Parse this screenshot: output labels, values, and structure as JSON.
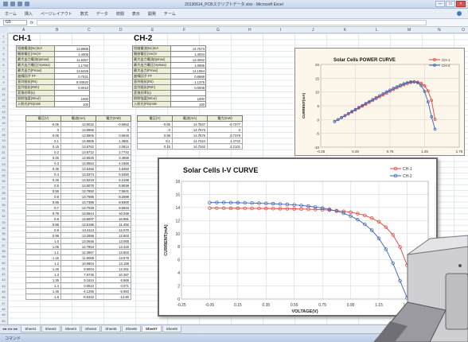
{
  "window": {
    "title": "20130614_PCBスクリプトデータ.xlsx - Microsoft Excel",
    "minimize": "—",
    "maximize": "□",
    "close": "×"
  },
  "ribbon": {
    "tabs": [
      "ホーム",
      "挿入",
      "ページレイアウト",
      "数式",
      "データ",
      "校閲",
      "表示",
      "開発",
      "チーム"
    ]
  },
  "formula": {
    "namebox": "G5",
    "fx": "fx",
    "value": ""
  },
  "columns": [
    "A",
    "B",
    "C",
    "D",
    "E",
    "F",
    "G",
    "H",
    "I",
    "J",
    "K",
    "L",
    "M",
    "N",
    "O"
  ],
  "rows": [
    "1",
    "2",
    "3",
    "4",
    "5",
    "6",
    "7",
    "8",
    "9",
    "10",
    "11",
    "12",
    "13",
    "14",
    "15",
    "16",
    "17",
    "18",
    "19",
    "20",
    "21",
    "22",
    "23",
    "24",
    "25",
    "26",
    "27",
    "28",
    "29",
    "30",
    "31",
    "32",
    "33",
    "34",
    "35",
    "36",
    "37",
    "38",
    "39",
    "40",
    "41",
    "42",
    "43",
    "44",
    "45",
    "46",
    "47",
    "48",
    "49",
    "50"
  ],
  "ch1": {
    "title": "CH-1",
    "params": [
      [
        "短絡電流(Isc)mA",
        "13.8966"
      ],
      [
        "開放電圧(Voc)V",
        "1.4006"
      ],
      [
        "最大出力電流(Ipmax)",
        "11.6357"
      ],
      [
        "最大出力電圧(Vpmax)",
        "1.1750"
      ],
      [
        "最大出力(Pmax)",
        "13.6426"
      ],
      [
        "曲線因子 FF",
        "0.7021"
      ],
      [
        "直列抵抗(Rs)",
        "0.00920"
      ],
      [
        "並列抵抗(Rsh)",
        "0.0010"
      ],
      [
        "変換効率(η)",
        ""
      ],
      [
        "照射強度(W/㎡)",
        "1000"
      ],
      [
        "入射光(Pin)mW",
        "100"
      ]
    ],
    "headers": [
      "電圧(V)",
      "電流(mA)",
      "電力(mW)"
    ],
    "data": [
      [
        "-0.05",
        "13.9032",
        "-0.6952"
      ],
      [
        "0",
        "13.8966",
        "0"
      ],
      [
        "0.05",
        "13.8905",
        "0.6945"
      ],
      [
        "0.1",
        "13.8806",
        "1.3881"
      ],
      [
        "0.15",
        "13.8762",
        "2.0814"
      ],
      [
        "0.2",
        "13.8712",
        "2.7742"
      ],
      [
        "0.25",
        "13.8625",
        "3.4656"
      ],
      [
        "0.3",
        "13.8554",
        "4.1566"
      ],
      [
        "0.35",
        "13.8458",
        "4.8460"
      ],
      [
        "0.4",
        "13.8374",
        "5.5350"
      ],
      [
        "0.45",
        "13.8218",
        "6.2198"
      ],
      [
        "0.5",
        "13.8076",
        "6.9038"
      ],
      [
        "0.55",
        "13.7893",
        "7.5841"
      ],
      [
        "0.6",
        "13.7665",
        "8.2599"
      ],
      [
        "0.65",
        "13.7385",
        "8.9300"
      ],
      [
        "0.7",
        "13.7033",
        "9.5923"
      ],
      [
        "0.75",
        "13.6614",
        "10.246"
      ],
      [
        "0.8",
        "13.6007",
        "10.881"
      ],
      [
        "0.85",
        "13.5196",
        "11.492"
      ],
      [
        "0.9",
        "13.4113",
        "12.070"
      ],
      [
        "0.95",
        "13.2658",
        "12.603"
      ],
      [
        "1.0",
        "13.0646",
        "13.065"
      ],
      [
        "1.05",
        "12.7853",
        "13.425"
      ],
      [
        "1.1",
        "12.3667",
        "13.603"
      ],
      [
        "1.15",
        "11.8069",
        "13.578"
      ],
      [
        "1.2",
        "10.9904",
        "13.188"
      ],
      [
        "1.25",
        "9.8004",
        "12.251"
      ],
      [
        "1.3",
        "7.9745",
        "10.367"
      ],
      [
        "1.35",
        "5.1624",
        "6.969"
      ],
      [
        "1.4",
        "0.0510",
        "0.071"
      ],
      [
        "1.45",
        "-4.1265",
        "-5.983"
      ],
      [
        "1.5",
        "-8.5342",
        "-12.80"
      ]
    ]
  },
  "ch2": {
    "title": "CH-2",
    "params": [
      [
        "短絡電流(Isc)mA",
        "14.7573"
      ],
      [
        "開放電圧(Voc)V",
        "1.4004"
      ],
      [
        "最大出力電流(Ipmax)",
        "13.3052"
      ],
      [
        "最大出力電圧(Vpmax)",
        "1.0695"
      ],
      [
        "最大出力(Pmax)",
        "14.1954"
      ],
      [
        "曲線因子 FF",
        "0.6869"
      ],
      [
        "直列抵抗(Rs)",
        "1.1375"
      ],
      [
        "並列抵抗(Rsh)",
        "0.0008"
      ],
      [
        "変換効率(η)",
        ""
      ],
      [
        "照射強度(W/㎡)",
        "1000"
      ],
      [
        "入射光(Pin)mW",
        "100"
      ]
    ],
    "headers": [
      "電圧(V)",
      "電流(mA)",
      "電力(mW)"
    ],
    "data": [
      [
        "-0.05",
        "14.7547",
        "-0.7377"
      ],
      [
        "0",
        "14.7573",
        "0"
      ],
      [
        "0.05",
        "14.7576",
        "0.7379"
      ],
      [
        "0.1",
        "14.7424",
        "1.4742"
      ],
      [
        "0.15",
        "14.7342",
        "2.2101"
      ]
    ]
  },
  "sheets": [
    "Sheet1",
    "Sheet2",
    "Sheet3",
    "Sheet4",
    "Sheet5",
    "Sheet6",
    "Sheet7",
    "Sheet8"
  ],
  "active_sheet": "Sheet7",
  "status": "コマンド",
  "chart_data": [
    {
      "type": "line",
      "title": "Solar Cells POWER CURVE",
      "xlabel": "",
      "ylabel": "CURRENT(mA)",
      "xlim": [
        -0.25,
        1.75
      ],
      "ylim": [
        -10,
        20
      ],
      "xticks": [
        "-0.25",
        "0.25",
        "0.75",
        "1.25",
        "1.75"
      ],
      "yticks": [
        "-10",
        "-5",
        "0",
        "5",
        "10",
        "15",
        "20"
      ],
      "grid": true,
      "legend": "top-right",
      "x": [
        -0.05,
        0,
        0.05,
        0.1,
        0.15,
        0.2,
        0.25,
        0.3,
        0.35,
        0.4,
        0.45,
        0.5,
        0.55,
        0.6,
        0.65,
        0.7,
        0.75,
        0.8,
        0.85,
        0.9,
        0.95,
        1.0,
        1.05,
        1.1,
        1.15,
        1.2,
        1.25,
        1.3,
        1.35,
        1.4
      ],
      "series": [
        {
          "name": "CH-1",
          "color": "#e0443a",
          "values": [
            -0.7,
            0,
            0.7,
            1.39,
            2.08,
            2.77,
            3.47,
            4.16,
            4.85,
            5.54,
            6.22,
            6.9,
            7.58,
            8.26,
            8.93,
            9.59,
            10.25,
            10.88,
            11.49,
            12.07,
            12.6,
            13.07,
            13.43,
            13.6,
            13.58,
            13.19,
            12.25,
            10.37,
            6.97,
            0.07
          ]
        },
        {
          "name": "CH-2",
          "color": "#3a62b8",
          "values": [
            -0.74,
            0,
            0.74,
            1.47,
            2.21,
            2.94,
            3.67,
            4.4,
            5.13,
            5.85,
            6.57,
            7.28,
            7.99,
            8.69,
            9.38,
            10.05,
            10.71,
            11.34,
            11.94,
            12.51,
            13.01,
            13.42,
            13.68,
            13.72,
            13.35,
            12.33,
            10.2,
            6.4,
            1.0,
            -3.5
          ]
        }
      ]
    },
    {
      "type": "line",
      "title": "Solar Cells I-V CURVE",
      "xlabel": "VOLTAGE(V)",
      "ylabel": "CURRENT(mA)",
      "xlim": [
        -0.25,
        1.5
      ],
      "ylim": [
        0,
        18
      ],
      "xticks": [
        "-0.25",
        "-0.05",
        "0.15",
        "0.35",
        "0.55",
        "0.75",
        "0.95",
        "1.15",
        "1.35",
        "1.55"
      ],
      "yticks": [
        "0",
        "2",
        "4",
        "6",
        "8",
        "10",
        "12",
        "14",
        "16",
        "18"
      ],
      "grid": true,
      "legend": "top-right",
      "x": [
        -0.05,
        0,
        0.05,
        0.1,
        0.15,
        0.2,
        0.25,
        0.3,
        0.35,
        0.4,
        0.45,
        0.5,
        0.55,
        0.6,
        0.65,
        0.7,
        0.75,
        0.8,
        0.85,
        0.9,
        0.95,
        1.0,
        1.05,
        1.1,
        1.15,
        1.2,
        1.25,
        1.3,
        1.35
      ],
      "series": [
        {
          "name": "CH-1",
          "color": "#e0443a",
          "values": [
            13.9,
            13.9,
            13.89,
            13.88,
            13.88,
            13.87,
            13.86,
            13.86,
            13.85,
            13.84,
            13.82,
            13.81,
            13.79,
            13.77,
            13.74,
            13.7,
            13.66,
            13.6,
            13.52,
            13.41,
            13.27,
            13.06,
            12.79,
            12.37,
            11.81,
            10.99,
            9.8,
            7.97,
            5.16
          ]
        },
        {
          "name": "CH-2",
          "color": "#3a62b8",
          "values": [
            14.75,
            14.76,
            14.76,
            14.74,
            14.73,
            14.71,
            14.68,
            14.65,
            14.62,
            14.58,
            14.53,
            14.47,
            14.4,
            14.31,
            14.2,
            14.07,
            13.91,
            13.71,
            13.45,
            13.12,
            12.69,
            12.14,
            11.44,
            10.52,
            9.27,
            7.62,
            5.48,
            2.8,
            0.2
          ]
        }
      ]
    }
  ]
}
